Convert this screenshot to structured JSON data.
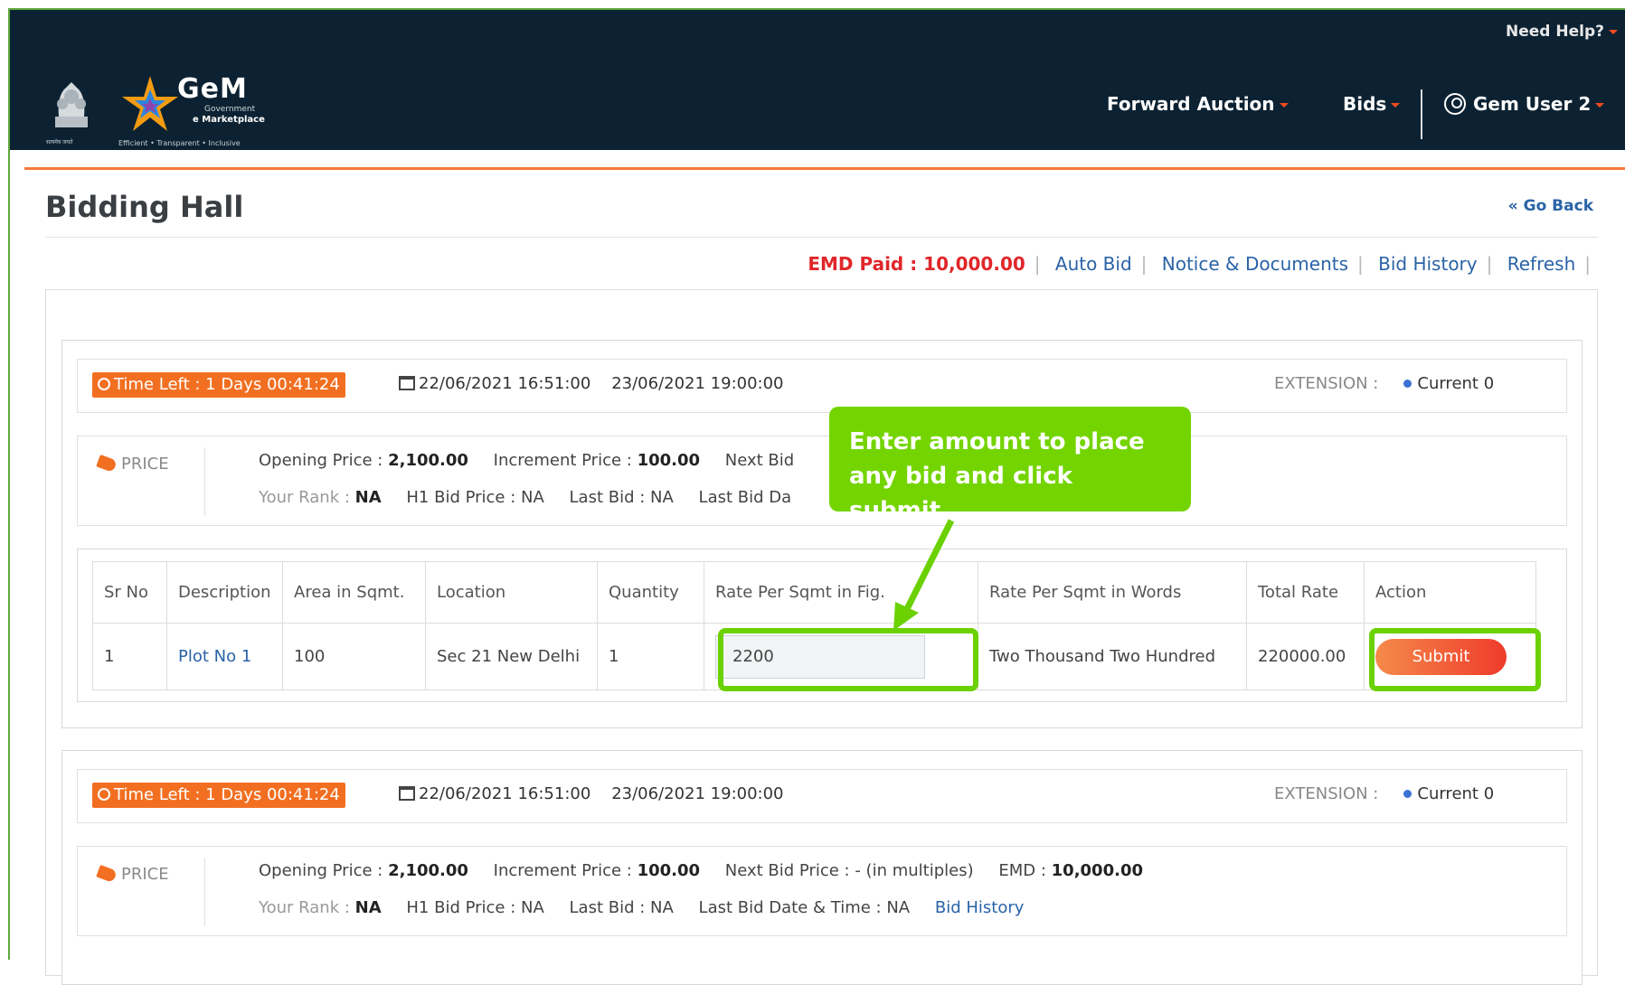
{
  "header": {
    "need_help": "Need Help?",
    "logo_title": "GeM",
    "logo_subtitle_1": "Government",
    "logo_subtitle_2": "e Marketplace",
    "logo_tagline": "Efficient • Transparent • Inclusive",
    "emblem_caption": "सत्यमेव जयते",
    "nav": {
      "forward_auction": "Forward Auction",
      "bids": "Bids",
      "user": "Gem User 2"
    },
    "accent_color": "#f04a23"
  },
  "page": {
    "title": "Bidding Hall",
    "go_back": "« Go Back"
  },
  "toolbar": {
    "emd_paid": "EMD Paid : 10,000.00",
    "auto_bid": "Auto Bid",
    "notice_documents": "Notice & Documents",
    "bid_history": "Bid History",
    "refresh": "Refresh"
  },
  "auctions": [
    {
      "time_left": "Time Left : 1 Days 00:41:24",
      "start_date": "22/06/2021 16:51:00",
      "end_date": "23/06/2021 19:00:00",
      "extension_label": "EXTENSION :",
      "extension_current": "Current 0",
      "price_label": "PRICE",
      "opening_price_label": "Opening Price :",
      "opening_price": "2,100.00",
      "increment_price_label": "Increment Price :",
      "increment_price": "100.00",
      "next_bid_label": "Next Bid",
      "rank_label": "Your Rank :",
      "rank": "NA",
      "h1_bid": "H1 Bid Price : NA",
      "last_bid": "Last Bid : NA",
      "last_bid_date": "Last Bid Da",
      "table": {
        "headers": [
          "Sr No",
          "Description",
          "Area in Sqmt.",
          "Location",
          "Quantity",
          "Rate Per Sqmt in Fig.",
          "Rate Per Sqmt in Words",
          "Total Rate",
          "Action"
        ],
        "row": {
          "sr": "1",
          "description": "Plot No 1",
          "area": "100",
          "location": "Sec 21 New Delhi",
          "quantity": "1",
          "rate_fig": "2200",
          "rate_words": "Two Thousand Two Hundred",
          "total": "220000.00",
          "action": "Submit"
        }
      }
    },
    {
      "time_left": "Time Left : 1 Days 00:41:24",
      "start_date": "22/06/2021 16:51:00",
      "end_date": "23/06/2021 19:00:00",
      "extension_label": "EXTENSION :",
      "extension_current": "Current 0",
      "price_label": "PRICE",
      "opening_price_label": "Opening Price :",
      "opening_price": "2,100.00",
      "increment_price_label": "Increment Price :",
      "increment_price": "100.00",
      "next_bid_full": "Next Bid Price : - (in multiples)",
      "emd_label": "EMD :",
      "emd_value": "10,000.00",
      "rank_label": "Your Rank :",
      "rank": "NA",
      "h1_bid": "H1 Bid Price : NA",
      "last_bid": "Last Bid : NA",
      "last_bid_date": "Last Bid Date & Time : NA",
      "bid_history": "Bid History"
    }
  ],
  "callout": {
    "line1": "Enter amount to place",
    "line2": "any bid and click submit.",
    "color": "#74d400"
  }
}
